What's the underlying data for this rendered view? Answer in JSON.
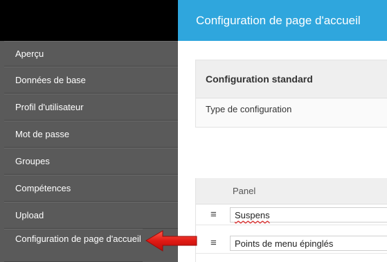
{
  "sidebar": {
    "items": [
      {
        "label": "Aperçu"
      },
      {
        "label": "Données de base"
      },
      {
        "label": "Profil d'utilisateur"
      },
      {
        "label": "Mot de passe"
      },
      {
        "label": "Groupes"
      },
      {
        "label": "Compétences"
      },
      {
        "label": "Upload"
      },
      {
        "label": "Configuration de page d'accueil"
      }
    ]
  },
  "header": {
    "title": "Configuration de page d'accueil"
  },
  "standard_config": {
    "title": "Configuration standard",
    "type_label": "Type de configuration"
  },
  "panel_table": {
    "header": "Panel",
    "rows": [
      {
        "value": "Suspens"
      },
      {
        "value": "Points de menu épinglés"
      }
    ]
  },
  "icons": {
    "drag_handle": "hamburger-icon",
    "annotation": "red-arrow-icon"
  },
  "colors": {
    "header_bg": "#2fa6dd",
    "sidebar_bg": "#5a5a5a",
    "sidebar_top": "#000000",
    "arrow": "#e02020"
  }
}
